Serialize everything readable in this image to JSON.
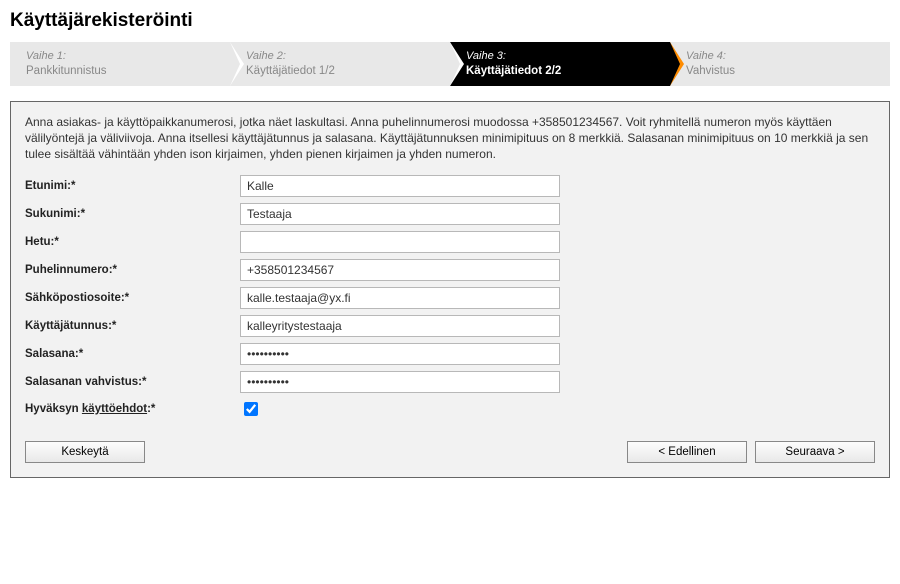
{
  "page_title": "Käyttäjärekisteröinti",
  "steps": [
    {
      "label": "Vaihe 1:",
      "name": "Pankkitunnistus"
    },
    {
      "label": "Vaihe 2:",
      "name": "Käyttäjätiedot 1/2"
    },
    {
      "label": "Vaihe 3:",
      "name": "Käyttäjätiedot 2/2"
    },
    {
      "label": "Vaihe 4:",
      "name": "Vahvistus"
    }
  ],
  "intro": "Anna asiakas- ja käyttöpaikkanumerosi, jotka näet laskultasi. Anna puhelinnumerosi muodossa +358501234567. Voit ryhmitellä numeron myös käyttäen välilyöntejä ja väliviivoja. Anna itsellesi käyttäjätunnus ja salasana. Käyttäjätunnuksen minimipituus on 8 merkkiä. Salasanan minimipituus on 10 merkkiä ja sen tulee sisältää vähintään yhden ison kirjaimen, yhden pienen kirjaimen ja yhden numeron.",
  "fields": {
    "etunimi": {
      "label": "Etunimi:*",
      "value": "Kalle"
    },
    "sukunimi": {
      "label": "Sukunimi:*",
      "value": "Testaaja"
    },
    "hetu": {
      "label": "Hetu:*",
      "value": ""
    },
    "puhelin": {
      "label": "Puhelinnumero:*",
      "value": "+358501234567"
    },
    "email": {
      "label": "Sähköpostiosoite:*",
      "value": "kalle.testaaja@yx.fi"
    },
    "tunnus": {
      "label": "Käyttäjätunnus:*",
      "value": "kalleyritystestaaja"
    },
    "salasana": {
      "label": "Salasana:*",
      "value": "••••••••••"
    },
    "salasana2": {
      "label": "Salasanan vahvistus:*",
      "value": "••••••••••"
    },
    "ehdot": {
      "label_prefix": "Hyväksyn ",
      "label_link": "käyttöehdot",
      "label_suffix": ":*",
      "checked": true
    }
  },
  "buttons": {
    "cancel": "Keskeytä",
    "prev": "< Edellinen",
    "next": "Seuraava >"
  }
}
